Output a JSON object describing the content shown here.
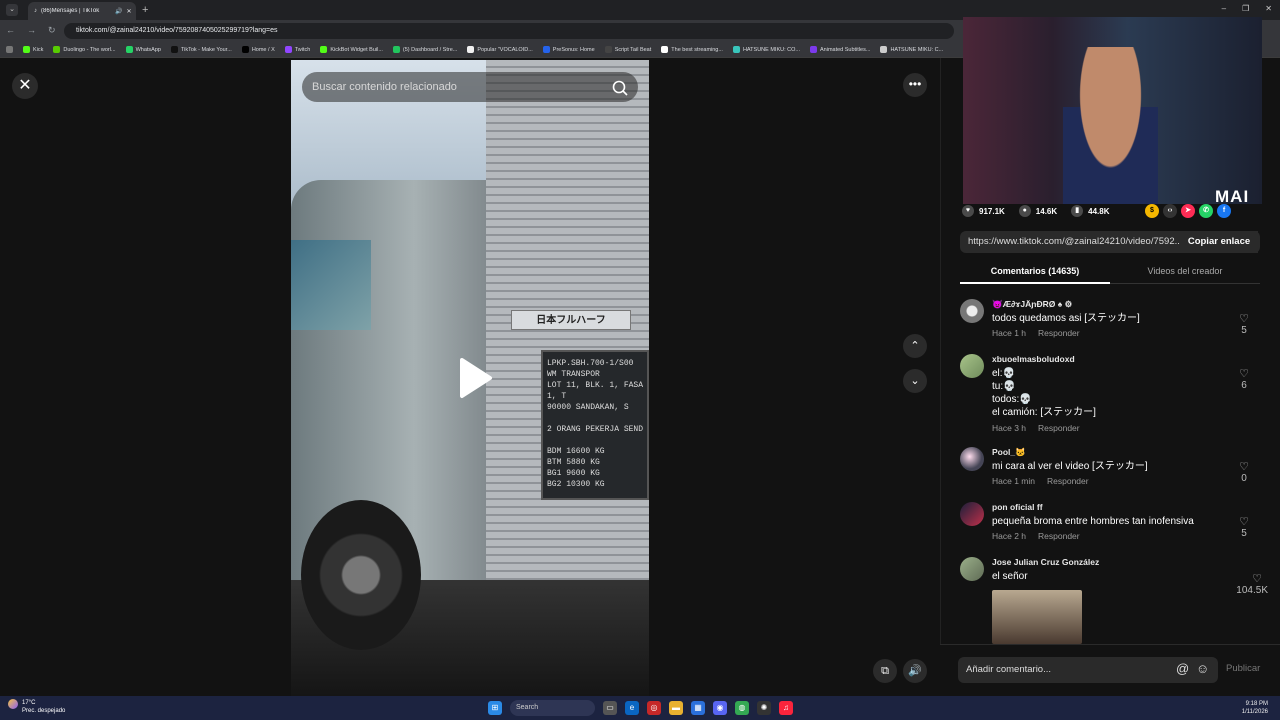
{
  "browser": {
    "tab_title": "(86)Mensajes | TikTok",
    "url": "tiktok.com/@zainal24210/video/7592087405025299719?lang=es",
    "bookmarks": [
      {
        "label": "Kick",
        "color": "#53fc18"
      },
      {
        "label": "Duolingo - The worl...",
        "color": "#58cc02"
      },
      {
        "label": "WhatsApp",
        "color": "#25d366"
      },
      {
        "label": "TikTok - Make Your...",
        "color": "#111111"
      },
      {
        "label": "Home / X",
        "color": "#000000"
      },
      {
        "label": "Twitch",
        "color": "#9146ff"
      },
      {
        "label": "KickBot Widget Buil...",
        "color": "#53fc18"
      },
      {
        "label": "(5) Dashboard / Stre...",
        "color": "#22c55e"
      },
      {
        "label": "Popular \"VOCALOID...",
        "color": "#f0f0f0"
      },
      {
        "label": "PreSonus: Home",
        "color": "#2563eb"
      },
      {
        "label": "Script Tail Beat",
        "color": "#444444"
      },
      {
        "label": "The best streaming...",
        "color": "#ffffff"
      },
      {
        "label": "HATSUNE MIKU: CO...",
        "color": "#39c5bb"
      },
      {
        "label": "Animated Subtitles...",
        "color": "#7c3aed"
      },
      {
        "label": "HATSUNE MIKU: C...",
        "color": "#cccccc"
      }
    ]
  },
  "video": {
    "search_placeholder": "Buscar contenido relacionado",
    "nameplate_text": "日本フルハーフ",
    "plate_lines": [
      "LPKP.SBH.700-1/S00",
      "WM TRANSPOR",
      "LOT 11, BLK. 1, FASA 1, T",
      "90000 SANDAKAN, S",
      "",
      "2 ORANG PEKERJA SEND",
      "",
      "BDM 16600 KG",
      "BTM  5880 KG",
      "BG1  9600 KG",
      "BG2 10300 KG"
    ]
  },
  "stats": {
    "likes": "917.1K",
    "comments": "14.6K",
    "saves": "44.8K"
  },
  "share": {
    "link": "https://www.tiktok.com/@zainal24210/video/7592...",
    "copy_label": "Copiar enlace"
  },
  "tabs": {
    "comments": "Comentarios (14635)",
    "creator_videos": "Videos del creador"
  },
  "webcam": {
    "logo": "MAI"
  },
  "comments": [
    {
      "user": "👿Æ∂ɤJÄɲĐRØ ♠ ⚙",
      "text": "todos quedamos asi [ステッカー]",
      "time": "Hace 1 h",
      "reply": "Responder",
      "likes": "5"
    },
    {
      "user": "xbuoelmasboludoxd",
      "text": "el:💀\ntu:💀\ntodos:💀\nel camión: [ステッカー]",
      "time": "Hace 3 h",
      "reply": "Responder",
      "likes": "6"
    },
    {
      "user": "Pool_🐱",
      "text": "mi cara al ver el video [ステッカー]",
      "time": "Hace 1 min",
      "reply": "Responder",
      "likes": "0"
    },
    {
      "user": "pon oficial ff",
      "text": "pequeña broma entre hombres tan inofensiva",
      "time": "Hace 2 h",
      "reply": "Responder",
      "likes": "5"
    },
    {
      "user": "Jose Julian Cruz González",
      "text": "el señor",
      "time": "",
      "reply": "",
      "likes": "104.5K"
    }
  ],
  "compose": {
    "placeholder": "Añadir comentario...",
    "publish": "Publicar"
  },
  "taskbar": {
    "temp": "17°C",
    "weather": "Prec. despejado",
    "search": "Search",
    "time": "9:18 PM",
    "date": "1/11/2026"
  }
}
